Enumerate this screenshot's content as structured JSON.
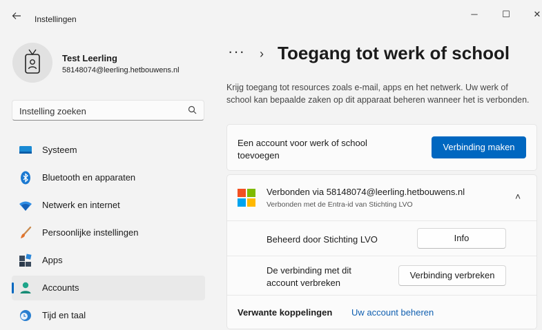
{
  "window": {
    "back_icon": "arrow-left-icon",
    "title": "Instellingen",
    "minimize": "─",
    "maximize": "☐",
    "close": "✕"
  },
  "profile": {
    "name": "Test Leerling",
    "email": "58148074@leerling.hetbouwens.nl",
    "avatar_icon": "id-badge-icon"
  },
  "search": {
    "placeholder": "Instelling zoeken",
    "icon": "search-icon"
  },
  "nav": {
    "items": [
      {
        "label": "Systeem",
        "icon": "monitor-icon"
      },
      {
        "label": "Bluetooth en apparaten",
        "icon": "bluetooth-icon"
      },
      {
        "label": "Netwerk en internet",
        "icon": "wifi-icon"
      },
      {
        "label": "Persoonlijke instellingen",
        "icon": "paintbrush-icon"
      },
      {
        "label": "Apps",
        "icon": "apps-icon"
      },
      {
        "label": "Accounts",
        "icon": "person-icon",
        "active": true
      },
      {
        "label": "Tijd en taal",
        "icon": "globe-clock-icon"
      }
    ],
    "accent_color": "#0067c0"
  },
  "header": {
    "breadcrumb_more": "···",
    "breadcrumb_sep": "›",
    "title": "Toegang tot werk of school",
    "description": "Krijg toegang tot resources zoals e-mail, apps en het netwerk. Uw werk of school kan bepaalde zaken op dit apparaat beheren wanneer het is verbonden."
  },
  "add_account": {
    "text": "Een account voor werk of school toevoegen",
    "button": "Verbinding maken"
  },
  "connected": {
    "title": "Verbonden via 58148074@leerling.hetbouwens.nl",
    "subtitle": "Verbonden met de Entra-id van Stichting LVO",
    "chevron": "˄",
    "managed_label": "Beheerd door Stichting LVO",
    "info_button": "Info",
    "disconnect_label": "De verbinding met dit account verbreken",
    "disconnect_button": "Verbinding verbreken"
  },
  "related": {
    "label": "Verwante koppelingen",
    "link": "Uw account beheren"
  }
}
